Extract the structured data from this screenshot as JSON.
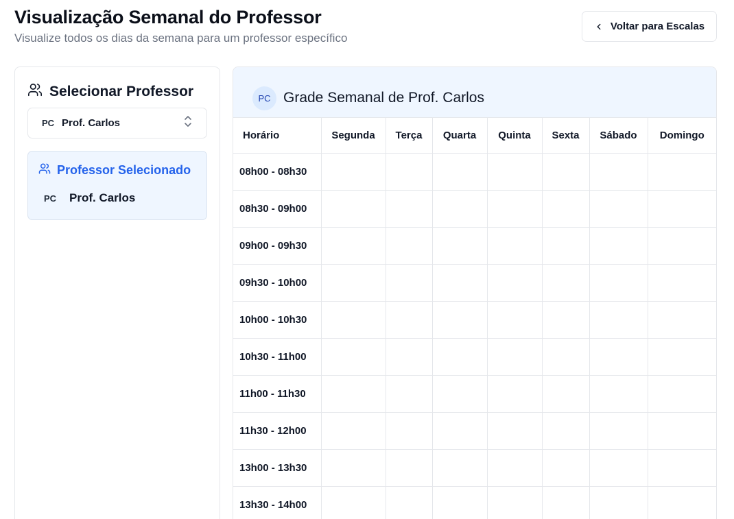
{
  "header": {
    "title": "Visualização Semanal do Professor",
    "subtitle": "Visualize todos os dias da semana para um professor específico",
    "back_button_label": "Voltar para Escalas",
    "back_icon": "chevron-left-icon"
  },
  "sidebar": {
    "title": "Selecionar Professor",
    "title_icon": "users-icon",
    "select": {
      "initials": "PC",
      "value": "Prof. Carlos",
      "icon": "chevrons-up-down-icon"
    },
    "selected_panel": {
      "heading": "Professor Selecionado",
      "icon": "users-icon",
      "initials": "PC",
      "name": "Prof. Carlos"
    }
  },
  "grid": {
    "avatar_initials": "PC",
    "title": "Grade Semanal de Prof. Carlos",
    "columns": [
      "Horário",
      "Segunda",
      "Terça",
      "Quarta",
      "Quinta",
      "Sexta",
      "Sábado",
      "Domingo"
    ],
    "time_slots": [
      "08h00 - 08h30",
      "08h30 - 09h00",
      "09h00 - 09h30",
      "09h30 - 10h00",
      "10h00 - 10h30",
      "10h30 - 11h00",
      "11h00 - 11h30",
      "11h30 - 12h00",
      "13h00 - 13h30",
      "13h30 - 14h00"
    ]
  },
  "colors": {
    "accent": "#2563eb",
    "panel_bg": "#eff6ff",
    "avatar_bg": "#dbeafe",
    "border": "#e5e7eb",
    "muted_text": "#6b7280"
  }
}
